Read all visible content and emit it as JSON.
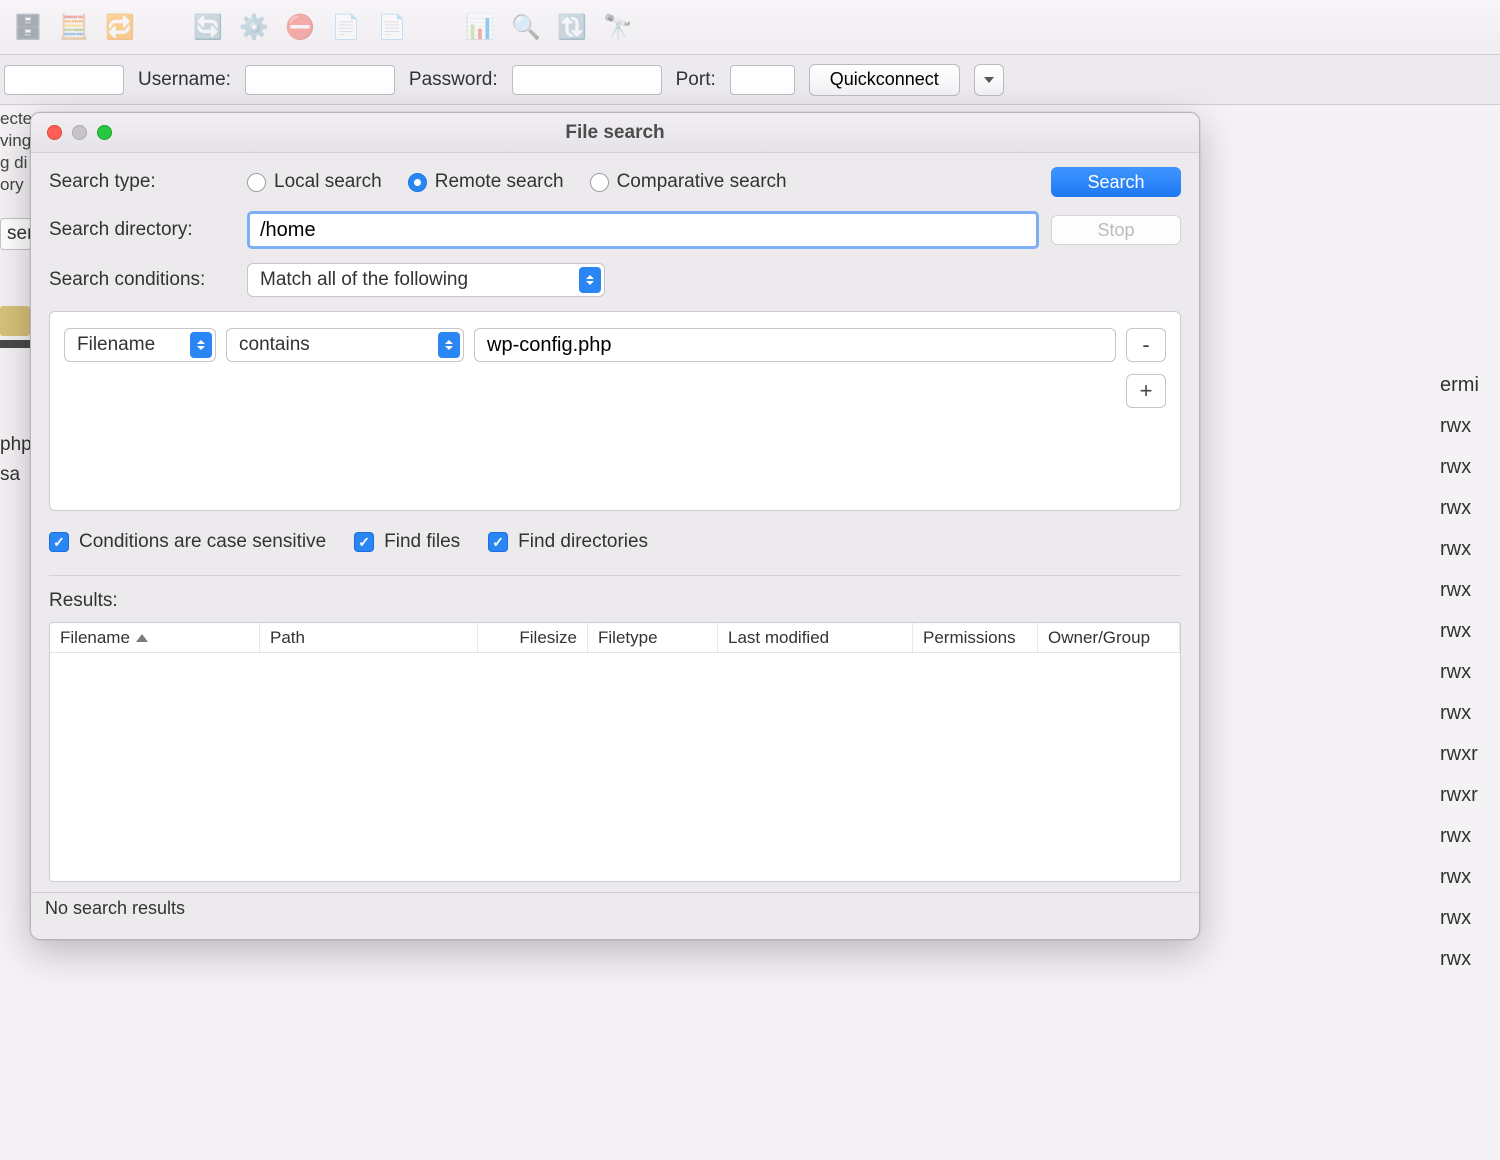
{
  "toolbar": {
    "icons": [
      "sitemanager",
      "toggle-panes",
      "sync-arrows",
      "refresh",
      "process-queue",
      "cancel",
      "list-x",
      "list-check",
      "compare",
      "search-files",
      "reconnect",
      "binoculars"
    ]
  },
  "connection": {
    "username_label": "Username:",
    "password_label": "Password:",
    "port_label": "Port:",
    "quickconnect_label": "Quickconnect"
  },
  "dialog": {
    "title": "File search",
    "labels": {
      "search_type": "Search type:",
      "search_directory": "Search directory:",
      "search_conditions": "Search conditions:",
      "results": "Results:"
    },
    "search_type_options": {
      "local": "Local search",
      "remote": "Remote search",
      "comparative": "Comparative search",
      "selected": "remote"
    },
    "buttons": {
      "search": "Search",
      "stop": "Stop"
    },
    "directory_value": "/home",
    "condition_match": "Match all of the following",
    "condition": {
      "field": "Filename",
      "operator": "contains",
      "value": "wp-config.php",
      "remove": "-",
      "add": "+"
    },
    "checkboxes": {
      "case_sensitive": "Conditions are case sensitive",
      "find_files": "Find files",
      "find_dirs": "Find directories"
    },
    "columns": {
      "filename": "Filename",
      "path": "Path",
      "filesize": "Filesize",
      "filetype": "Filetype",
      "last_modified": "Last modified",
      "permissions": "Permissions",
      "owner_group": "Owner/Group"
    },
    "status": "No search results"
  },
  "background": {
    "log_lines": [
      "ecte",
      "ving",
      "g di",
      "ory"
    ],
    "sers": "sers",
    "phps": "php",
    "sa": "sa",
    "ermi": "ermi",
    "perm_lines": [
      "rwx",
      "rwx",
      "rwx",
      "rwx",
      "rwx",
      "rwx",
      "rwx",
      "rwx",
      "rwxr",
      "rwxr",
      "rwx",
      "rwx",
      "rwx",
      "rwx"
    ]
  }
}
